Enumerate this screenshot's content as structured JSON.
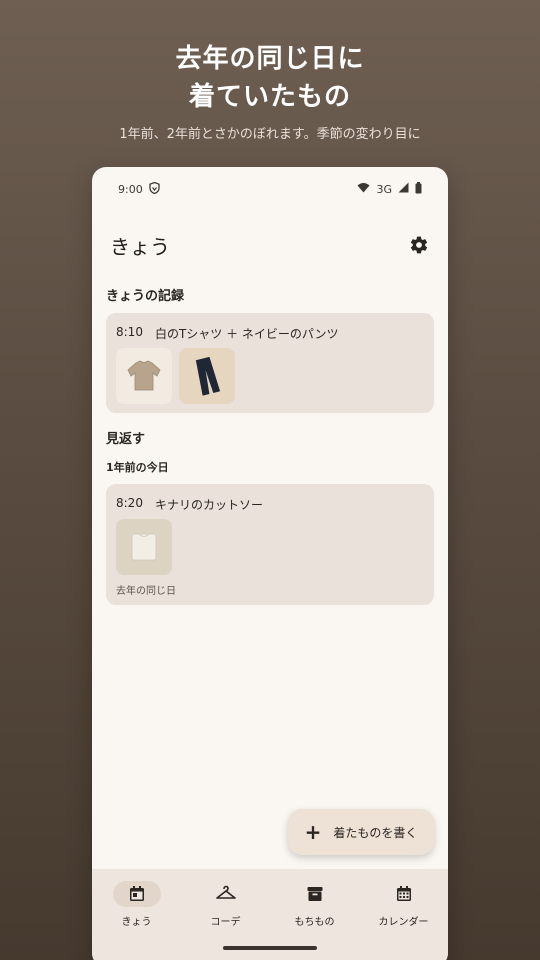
{
  "promo": {
    "title_line1": "去年の同じ日に",
    "title_line2": "着ていたもの",
    "subtitle": "1年前、2年前とさかのぼれます。季節の変わり目に"
  },
  "status_bar": {
    "time": "9:00",
    "network": "3G"
  },
  "header": {
    "title": "きょう",
    "settings_icon": "gear-icon"
  },
  "today": {
    "section_label": "きょうの記録",
    "entry": {
      "time": "8:10",
      "description": "白のTシャツ ＋ ネイビーのパンツ",
      "items": [
        {
          "icon": "beige-sweater-thumbnail"
        },
        {
          "icon": "navy-pants-thumbnail"
        }
      ]
    }
  },
  "lookback": {
    "section_label": "見返す",
    "sub_label": "1年前の今日",
    "entry": {
      "time": "8:20",
      "description": "キナリのカットソー",
      "items": [
        {
          "icon": "cream-cutsew-thumbnail"
        }
      ],
      "note": "去年の同じ日"
    }
  },
  "fab": {
    "label": "着たものを書く",
    "icon": "plus-icon"
  },
  "bottom_nav": {
    "items": [
      {
        "label": "きょう",
        "icon": "calendar-today-icon",
        "active": true
      },
      {
        "label": "コーデ",
        "icon": "hanger-icon",
        "active": false
      },
      {
        "label": "もちもの",
        "icon": "archive-box-icon",
        "active": false
      },
      {
        "label": "カレンダー",
        "icon": "calendar-month-icon",
        "active": false
      }
    ]
  },
  "colors": {
    "background_top": "#6e5f52",
    "background_bottom": "#463a2f",
    "phone_surface": "#faf6f2",
    "card": "#e9e1da",
    "fab": "#eee1d6",
    "nav_bar": "#ede5de"
  }
}
